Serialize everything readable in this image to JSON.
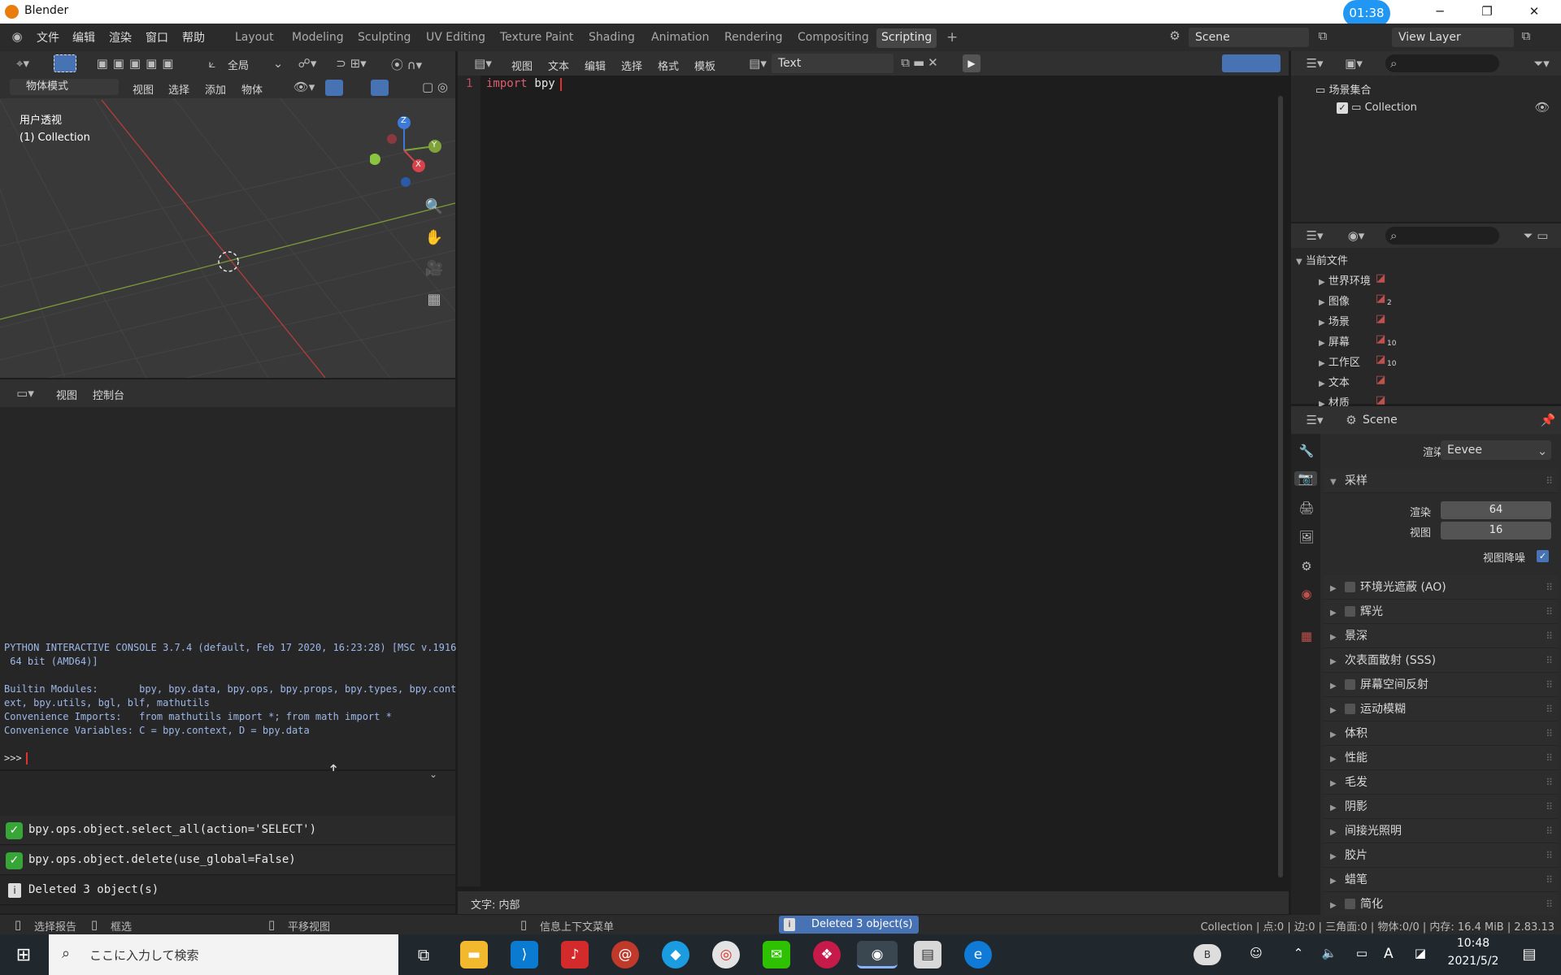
{
  "window": {
    "app_title": "Blender",
    "clock": "01:38",
    "minimize": "─",
    "maximize": "❐",
    "close": "✕"
  },
  "topbar": {
    "menus": [
      "文件",
      "编辑",
      "渲染",
      "窗口",
      "帮助"
    ],
    "workspaces": [
      "Layout",
      "Modeling",
      "Sculpting",
      "UV Editing",
      "Texture Paint",
      "Shading",
      "Animation",
      "Rendering",
      "Compositing",
      "Scripting"
    ],
    "active_workspace": "Scripting",
    "add_tab": "+",
    "scene": "Scene",
    "view_layer": "View Layer"
  },
  "viewport": {
    "transform_orientation": "全局",
    "mode": "物体模式",
    "menus": [
      "视图",
      "选择",
      "添加",
      "物体"
    ],
    "overlay_title": "用户透视",
    "overlay_collection": "(1) Collection",
    "axis_x": "X",
    "axis_y": "Y",
    "axis_z": "Z"
  },
  "console": {
    "menus": [
      "视图",
      "控制台"
    ],
    "lines": [
      "PYTHON INTERACTIVE CONSOLE 3.7.4 (default, Feb 17 2020, 16:23:28) [MSC v.1916",
      " 64 bit (AMD64)]",
      "",
      "Builtin Modules:       bpy, bpy.data, bpy.ops, bpy.props, bpy.types, bpy.cont",
      "ext, bpy.utils, bgl, blf, mathutils",
      "Convenience Imports:   from mathutils import *; from math import *",
      "Convenience Variables: C = bpy.context, D = bpy.data"
    ],
    "prompt": ">>>"
  },
  "info": {
    "entries": [
      {
        "kind": "ok",
        "text": "bpy.ops.object.select_all(action='SELECT')"
      },
      {
        "kind": "ok",
        "text": "bpy.ops.object.delete(use_global=False)"
      },
      {
        "kind": "info",
        "text": "Deleted 3 object(s)"
      }
    ]
  },
  "text_editor": {
    "menus": [
      "视图",
      "文本",
      "编辑",
      "选择",
      "格式",
      "模板"
    ],
    "datablock": "Text",
    "line_number": "1",
    "code_keyword": "import",
    "code_rest": " bpy",
    "footer": "文字: 内部"
  },
  "outliner": {
    "scene_collection": "场景集合",
    "collection": "Collection"
  },
  "data_browser": {
    "current_file": "当前文件",
    "items": [
      {
        "label": "世界环境",
        "badge": ""
      },
      {
        "label": "图像",
        "badge": "2"
      },
      {
        "label": "场景",
        "badge": ""
      },
      {
        "label": "屏幕",
        "badge": "10"
      },
      {
        "label": "工作区",
        "badge": "10"
      },
      {
        "label": "文本",
        "badge": ""
      },
      {
        "label": "材质",
        "badge": ""
      }
    ]
  },
  "properties": {
    "scene": "Scene",
    "render_engine_label": "渲染引擎",
    "render_engine": "Eevee",
    "sampling": {
      "title": "采样",
      "render_label": "渲染",
      "render_value": "64",
      "viewport_label": "视图",
      "viewport_value": "16",
      "denoise_label": "视图降噪"
    },
    "sections": [
      {
        "label": "环境光遮蔽 (AO)",
        "checkbox": true
      },
      {
        "label": "辉光",
        "checkbox": true
      },
      {
        "label": "景深",
        "checkbox": false
      },
      {
        "label": "次表面散射 (SSS)",
        "checkbox": false
      },
      {
        "label": "屏幕空间反射",
        "checkbox": true
      },
      {
        "label": "运动模糊",
        "checkbox": true
      },
      {
        "label": "体积",
        "checkbox": false
      },
      {
        "label": "性能",
        "checkbox": false
      },
      {
        "label": "毛发",
        "checkbox": false
      },
      {
        "label": "阴影",
        "checkbox": false
      },
      {
        "label": "间接光照明",
        "checkbox": false
      },
      {
        "label": "胶片",
        "checkbox": false
      },
      {
        "label": "蜡笔",
        "checkbox": false
      },
      {
        "label": "简化",
        "checkbox": true
      }
    ]
  },
  "statusbar": {
    "select_report": "选择报告",
    "box_select": "框选",
    "pan_view": "平移视图",
    "context_menu": "信息上下文菜单",
    "message": "Deleted 3 object(s)",
    "stats": "Collection | 点:0 | 边:0 | 三角面:0 | 物体:0/0 | 内存: 16.4 MiB | 2.83.13"
  },
  "taskbar": {
    "search_placeholder": "ここに入力して検索",
    "time": "10:48",
    "date": "2021/5/2",
    "ime": "A",
    "avatar": "B"
  },
  "colors": {
    "accent": "#4772b3",
    "keyword": "#e05c70",
    "prompt_cursor": "#e03030",
    "ok": "#37a537"
  }
}
